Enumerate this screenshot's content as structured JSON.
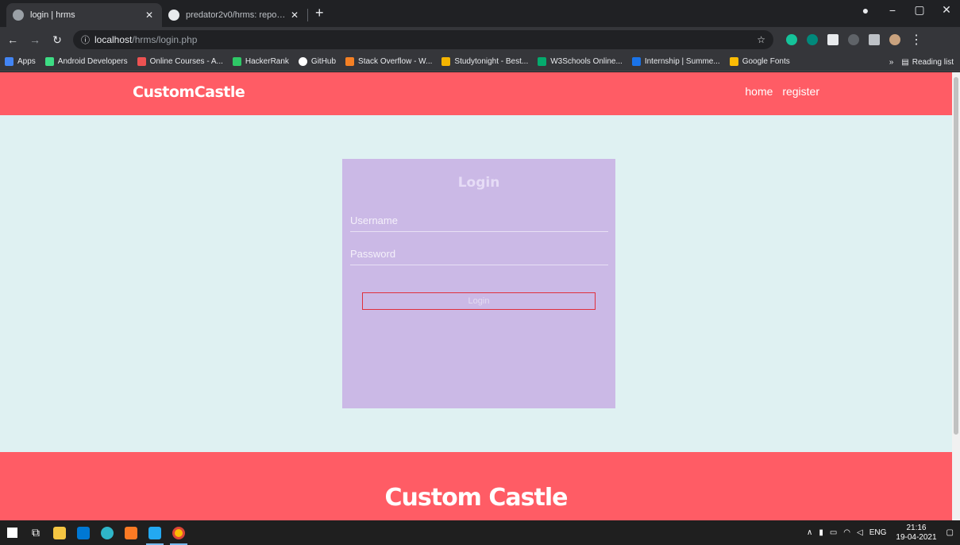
{
  "browser": {
    "tabs": [
      {
        "title": "login | hrms",
        "active": true
      },
      {
        "title": "predator2v0/hrms: repository for",
        "active": false
      }
    ],
    "new_tab": "+",
    "window_controls": {
      "minimize": "−",
      "maximize": "▢",
      "close": "✕"
    },
    "address": {
      "host": "localhost",
      "path": "/hrms/login.php"
    },
    "bookmarks": [
      {
        "label": "Apps",
        "color": "#4285f4"
      },
      {
        "label": "Android Developers",
        "color": "#3ddc84"
      },
      {
        "label": "Online Courses - A...",
        "color": "#ec5252"
      },
      {
        "label": "HackerRank",
        "color": "#2ec866"
      },
      {
        "label": "GitHub",
        "color": "#ffffff"
      },
      {
        "label": "Stack Overflow - W...",
        "color": "#f48024"
      },
      {
        "label": "Studytonight - Best...",
        "color": "#f4b400"
      },
      {
        "label": "W3Schools Online...",
        "color": "#04aa6d"
      },
      {
        "label": "Internship | Summe...",
        "color": "#1a73e8"
      },
      {
        "label": "Google Fonts",
        "color": "#fbbc04"
      }
    ],
    "reading_list": "Reading list",
    "more_bookmarks": "»"
  },
  "site": {
    "brand": "CustomCastle",
    "nav": {
      "home": "home",
      "register": "register"
    },
    "login": {
      "title": "Login",
      "username_placeholder": "Username",
      "password_placeholder": "Password",
      "button": "Login"
    },
    "footer_title": "Custom Castle"
  },
  "taskbar": {
    "language": "ENG",
    "time": "21:16",
    "date": "19-04-2021"
  },
  "colors": {
    "header": "#ff5c65",
    "page_bg": "#dff1f2",
    "card_bg": "#cbb9e6",
    "button_border": "#e0303c"
  }
}
